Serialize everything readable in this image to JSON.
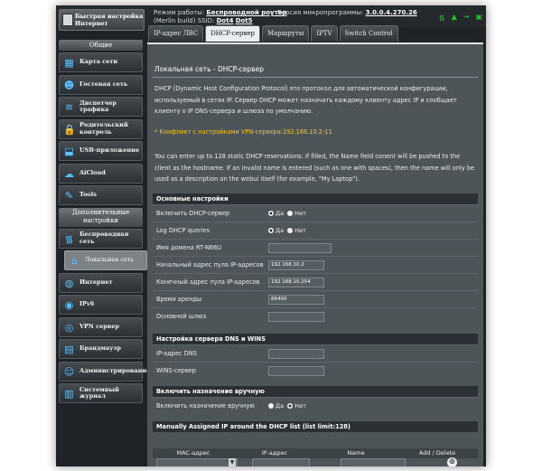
{
  "header": {
    "quick_setup": "Быстрая настройка Интернет",
    "mode_label": "Режим работы:",
    "mode_value": "Беспроводной роутер",
    "firmware_label": "Версия микропрограммы:",
    "firmware_value": "3.0.0.4.270.26",
    "merlin": "(Merlin build) SSID:",
    "ssid1": "Dot4",
    "ssid2": "Dot5",
    "status_icons": [
      "wifi-icon",
      "signal-icon",
      "usb-icon",
      "network-icon"
    ]
  },
  "sidebar": {
    "general_title": "Общие",
    "general_items": [
      {
        "label": "Карта сети",
        "icon": "network-map-icon"
      },
      {
        "label": "Гостевая сеть",
        "icon": "guest-network-icon"
      },
      {
        "label": "Диспетчер трафика",
        "icon": "traffic-manager-icon"
      },
      {
        "label": "Родительский контроль",
        "icon": "parental-control-icon"
      },
      {
        "label": "USB-приложение",
        "icon": "usb-app-icon"
      },
      {
        "label": "AiCloud",
        "icon": "aicloud-icon"
      },
      {
        "label": "Tools",
        "icon": "tools-icon"
      }
    ],
    "advanced_title": "Дополнительные настройки",
    "advanced_items": [
      {
        "label": "Беспроводная сеть",
        "icon": "wireless-icon"
      },
      {
        "label": "Локальная сеть",
        "icon": "lan-icon",
        "active": true
      },
      {
        "label": "Интернет",
        "icon": "internet-icon"
      },
      {
        "label": "IPv6",
        "icon": "ipv6-icon"
      },
      {
        "label": "VPN сервер",
        "icon": "vpn-icon"
      },
      {
        "label": "Брандмауэр",
        "icon": "firewall-icon"
      },
      {
        "label": "Администрирование",
        "icon": "admin-icon"
      },
      {
        "label": "Системный журнал",
        "icon": "syslog-icon"
      }
    ]
  },
  "tabs": [
    "IP-адрес ЛВС",
    "DHCP-сервер",
    "Маршруты",
    "IPTV",
    "Switch Control"
  ],
  "active_tab": "DHCP-сервер",
  "main": {
    "title": "Локальная сеть - DHCP-сервер",
    "desc1": "DHCP (Dynamic Host Configuration Protocol) это протокол для автоматической конфигурации, используемый в сетях IP. Сервер DHCP может назначать каждому клиенту адрес IP и сообщает клиенту о IP DNS-сервера и шлюза по умолчанию.",
    "warning": "* Конфликт с настройками VPN-сервера:192.168.10.2-11",
    "desc2": "You can enter up to 128 static DHCP reservations. If filled, the Name field conent will be pushed to the client as the hostname. If an invalid name is entered (such as one with spaces), then the name will only be used as a description on the webui itself (for example, \"My Laptop\").",
    "basic_title": "Основные настройки",
    "enable_dhcp": "Включить DHCP-сервер",
    "log_dhcp": "Log DHCP queries",
    "domain_name": "Имя домена RT-N66U",
    "pool_start": "Начальный адрес пула IP-адресов",
    "pool_start_value": "192.168.10.2",
    "pool_end": "Конечный адрес пула IP-адресов",
    "pool_end_value": "192.168.10.254",
    "lease_time": "Время аренды",
    "lease_time_value": "86400",
    "gateway": "Основной шлюз",
    "yes": "Да",
    "no": "Нет",
    "dns_title": "Настройка сервера DNS и WINS",
    "dns_ip": "IP-адрес DNS",
    "wins": "WINS-сервер",
    "manual_title": "Включить назначение вручную",
    "manual_enable": "Включить назначение вручную",
    "list_title": "Manually Assigned IP around the DHCP list (list limit:128)",
    "col_mac": "MAC-адрес",
    "col_ip": "IP-адрес",
    "col_name": "Name",
    "col_add": "Add / Delete"
  }
}
